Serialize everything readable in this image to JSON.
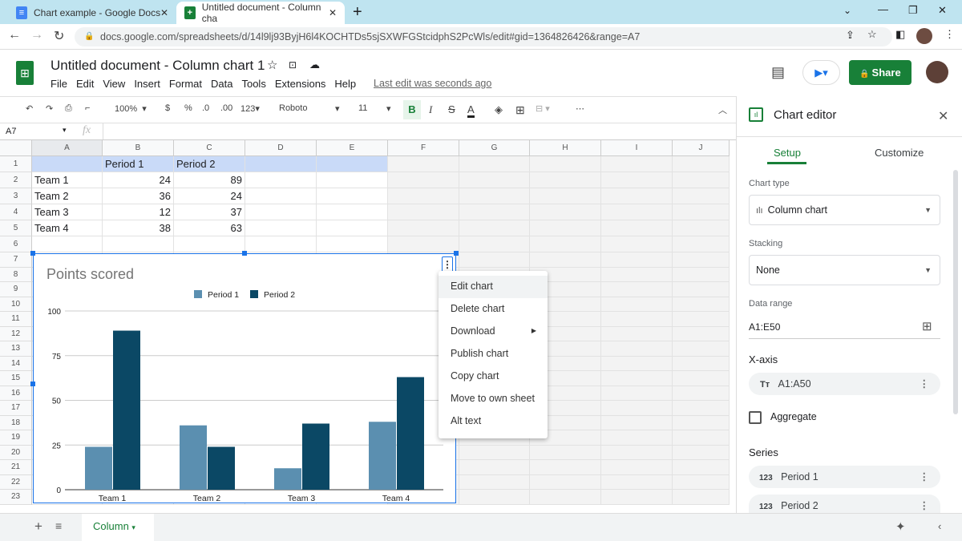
{
  "browser": {
    "tabs": [
      {
        "title": "Chart example - Google Docs"
      },
      {
        "title": "Untitled document - Column cha"
      }
    ],
    "url": "docs.google.com/spreadsheets/d/14l9lj93ByjH6l4KOCHTDs5sjSXWFGStcidphS2PcWls/edit#gid=1364826426&range=A7"
  },
  "app": {
    "title": "Untitled document - Column chart 1",
    "menu": [
      "File",
      "Edit",
      "View",
      "Insert",
      "Format",
      "Data",
      "Tools",
      "Extensions",
      "Help"
    ],
    "last_edit": "Last edit was seconds ago",
    "share": "Share",
    "accent": "#188038"
  },
  "toolbar": {
    "zoom": "100%",
    "currency": "$",
    "percent": "%",
    "dec_less": ".0",
    "dec_more": ".00",
    "format": "123",
    "font": "Roboto",
    "size": "11",
    "bold": "B",
    "italic": "I",
    "strike": "S",
    "textcolor": "A",
    "more": "⋯"
  },
  "formula": {
    "cell_ref": "A7",
    "fx": "fx"
  },
  "sheet": {
    "columns": [
      "A",
      "B",
      "C",
      "D",
      "E",
      "F",
      "G",
      "H",
      "I",
      "J"
    ],
    "rows": [
      [
        "",
        "Period 1",
        "Period 2"
      ],
      [
        "Team 1",
        "24",
        "89"
      ],
      [
        "Team 2",
        "36",
        "24"
      ],
      [
        "Team 3",
        "12",
        "37"
      ],
      [
        "Team 4",
        "38",
        "63"
      ]
    ],
    "row_numbers": [
      "1",
      "2",
      "3",
      "4",
      "5",
      "6",
      "7",
      "8",
      "9",
      "10",
      "11",
      "12",
      "13",
      "14",
      "15",
      "16",
      "17",
      "18",
      "19",
      "20",
      "21",
      "22",
      "23"
    ],
    "tab": "Column"
  },
  "chart_data": {
    "type": "bar",
    "title": "Points scored",
    "categories": [
      "Team 1",
      "Team 2",
      "Team 3",
      "Team 4"
    ],
    "series": [
      {
        "name": "Period 1",
        "values": [
          24,
          36,
          12,
          38
        ],
        "color": "#5b8fb0"
      },
      {
        "name": "Period 2",
        "values": [
          89,
          24,
          37,
          63
        ],
        "color": "#0b4865"
      }
    ],
    "yticks": [
      "0",
      "25",
      "50",
      "75",
      "100"
    ],
    "ylim": [
      0,
      100
    ],
    "grid": true,
    "legend": "top"
  },
  "context_menu": {
    "items": [
      "Edit chart",
      "Delete chart",
      "Download",
      "Publish chart",
      "Copy chart",
      "Move to own sheet",
      "Alt text"
    ]
  },
  "editor": {
    "title": "Chart editor",
    "tabs": [
      "Setup",
      "Customize"
    ],
    "chart_type_label": "Chart type",
    "chart_type": "Column chart",
    "stacking_label": "Stacking",
    "stacking": "None",
    "data_range_label": "Data range",
    "data_range": "A1:E50",
    "xaxis_label": "X-axis",
    "xaxis": "A1:A50",
    "aggregate": "Aggregate",
    "series_label": "Series",
    "series": [
      "Period 1",
      "Period 2"
    ],
    "xaxis_icon": "Tт",
    "series_icon": "123"
  }
}
